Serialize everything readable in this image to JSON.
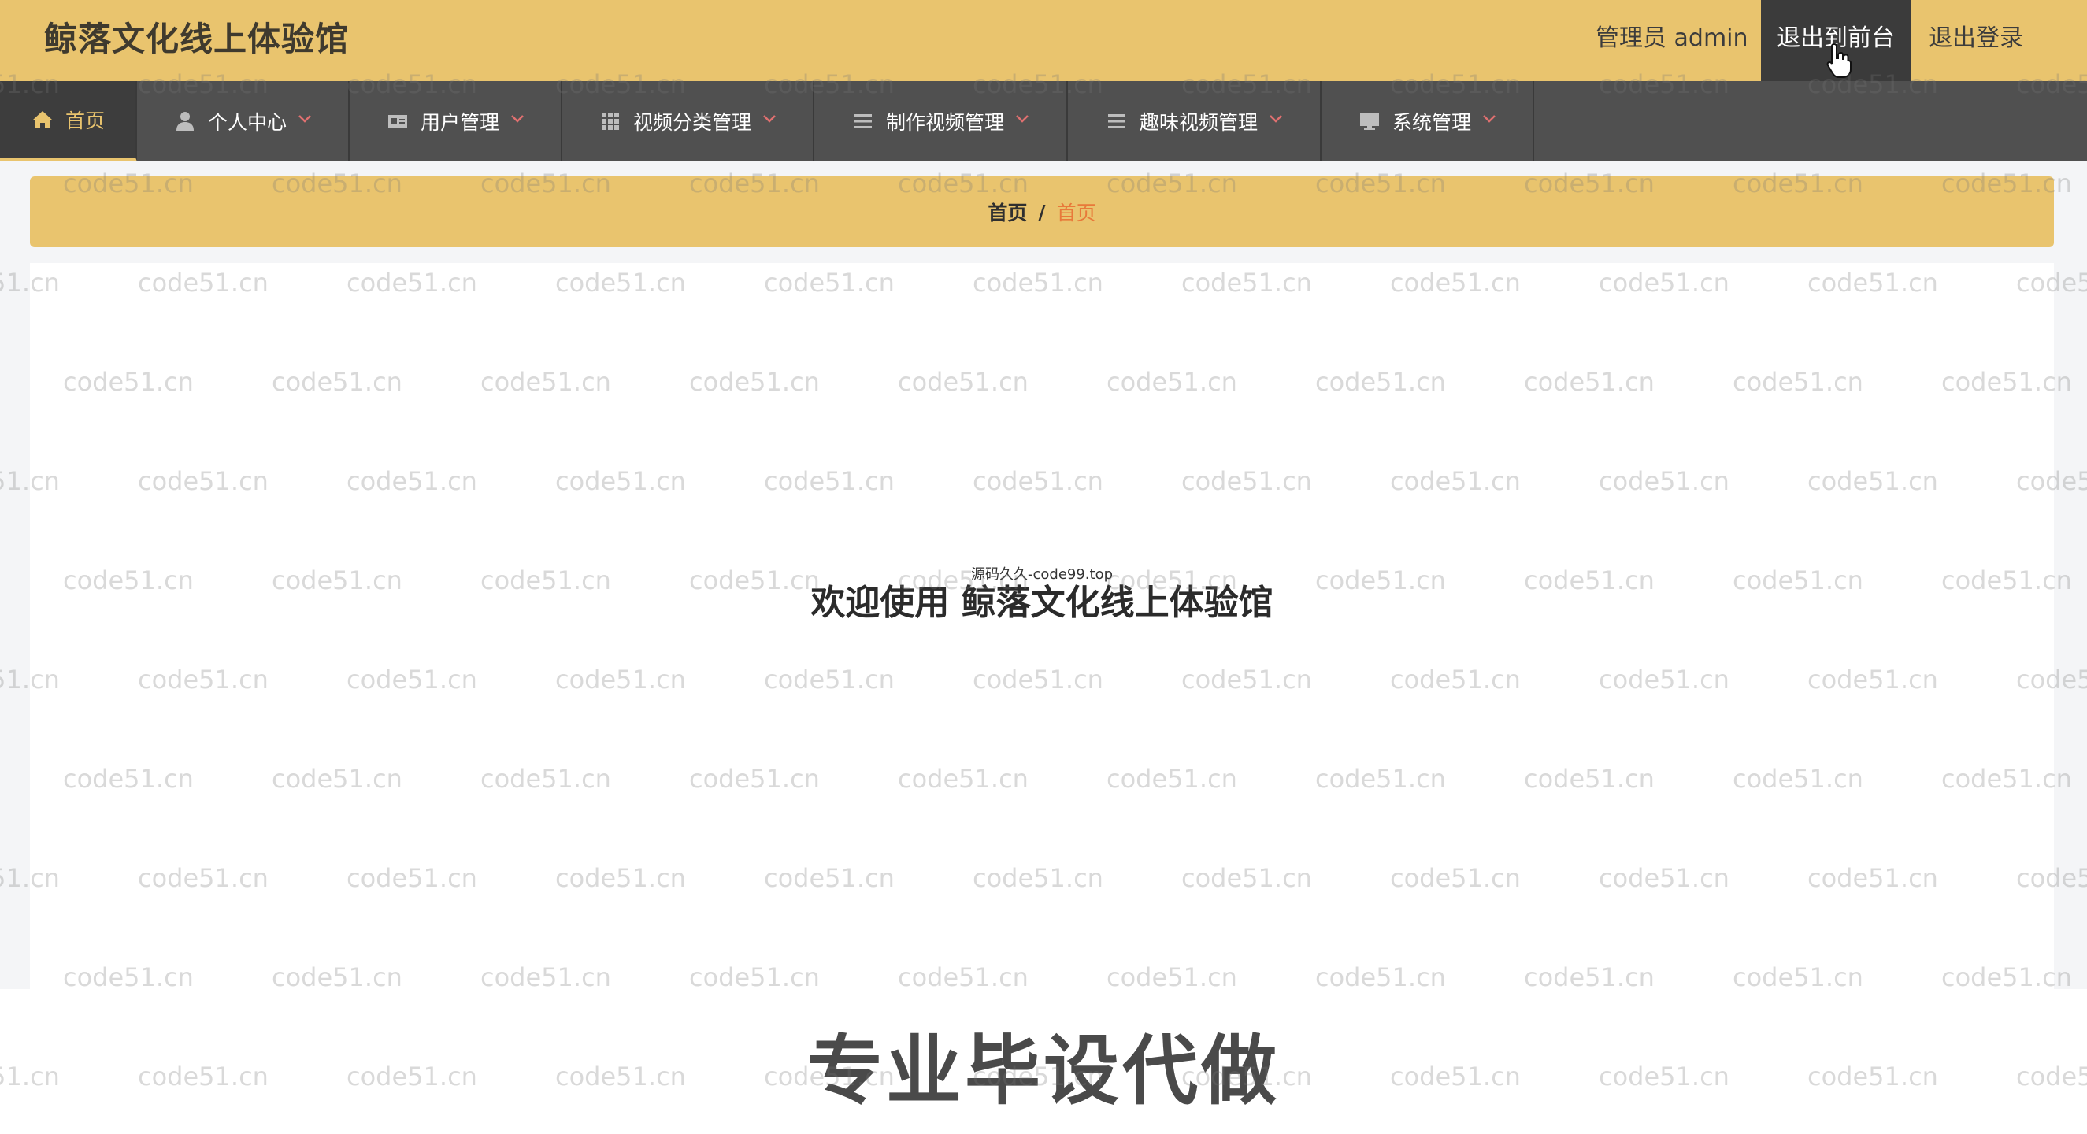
{
  "header": {
    "app_title": "鲸落文化线上体验馆",
    "admin_label": "管理员 admin",
    "exit_to_front_label": "退出到前台",
    "logout_label": "退出登录"
  },
  "nav": {
    "items": [
      {
        "label": "首页",
        "icon": "home-icon"
      },
      {
        "label": "个人中心",
        "icon": "person-icon"
      },
      {
        "label": "用户管理",
        "icon": "id-card-icon"
      },
      {
        "label": "视频分类管理",
        "icon": "grid-icon"
      },
      {
        "label": "制作视频管理",
        "icon": "list-icon"
      },
      {
        "label": "趣味视频管理",
        "icon": "list-icon"
      },
      {
        "label": "系统管理",
        "icon": "monitor-icon"
      }
    ]
  },
  "breadcrumb": {
    "root": "首页",
    "separator": "/",
    "current": "首页"
  },
  "main": {
    "small_note": "源码久久-code99.top",
    "welcome_text": "欢迎使用 鲸落文化线上体验馆"
  },
  "footer": {
    "promo_text": "专业毕设代做"
  },
  "watermark": {
    "text": "code51.cn"
  },
  "colors": {
    "accent": "#e9c46e",
    "nav_background": "#505050",
    "active_text": "#e9c46e",
    "breadcrumb_current": "#e8793a"
  }
}
